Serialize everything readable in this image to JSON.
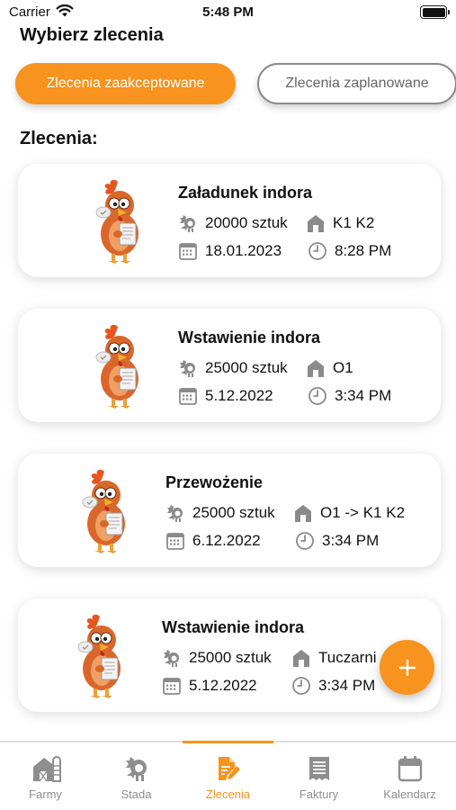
{
  "status_bar": {
    "carrier": "Carrier",
    "time": "5:48 PM"
  },
  "screen_title": "Wybierz zlecenia",
  "segments": [
    {
      "label": "Zlecenia zaakceptowane",
      "active": true
    },
    {
      "label": "Zlecenia zaplanowane",
      "active": false
    }
  ],
  "section_label": "Zlecenia:",
  "orders": [
    {
      "title": "Załadunek indora",
      "count": "20000 sztuk",
      "location": "K1 K2",
      "date": "18.01.2023",
      "time": "8:28 PM"
    },
    {
      "title": "Wstawienie indora",
      "count": "25000 sztuk",
      "location": "O1",
      "date": "5.12.2022",
      "time": "3:34 PM"
    },
    {
      "title": "Przewożenie",
      "count": "25000 sztuk",
      "location": "O1 -> K1 K2",
      "date": "6.12.2022",
      "time": "3:34 PM"
    },
    {
      "title": "Wstawienie indora",
      "count": "25000 sztuk",
      "location": "Tuczarni",
      "date": "5.12.2022",
      "time": "3:34 PM"
    }
  ],
  "fab": {
    "icon": "plus-icon"
  },
  "tabs": [
    {
      "label": "Farmy",
      "icon": "barn-icon",
      "active": false
    },
    {
      "label": "Stada",
      "icon": "turkey-icon",
      "active": false
    },
    {
      "label": "Zlecenia",
      "icon": "edit-document-icon",
      "active": true
    },
    {
      "label": "Faktury",
      "icon": "receipt-icon",
      "active": false
    },
    {
      "label": "Kalendarz",
      "icon": "calendar-icon",
      "active": false
    }
  ],
  "colors": {
    "accent": "#f7931e",
    "inactive_tab": "#8e8e8e",
    "icon_gray": "#8a8a8a"
  }
}
